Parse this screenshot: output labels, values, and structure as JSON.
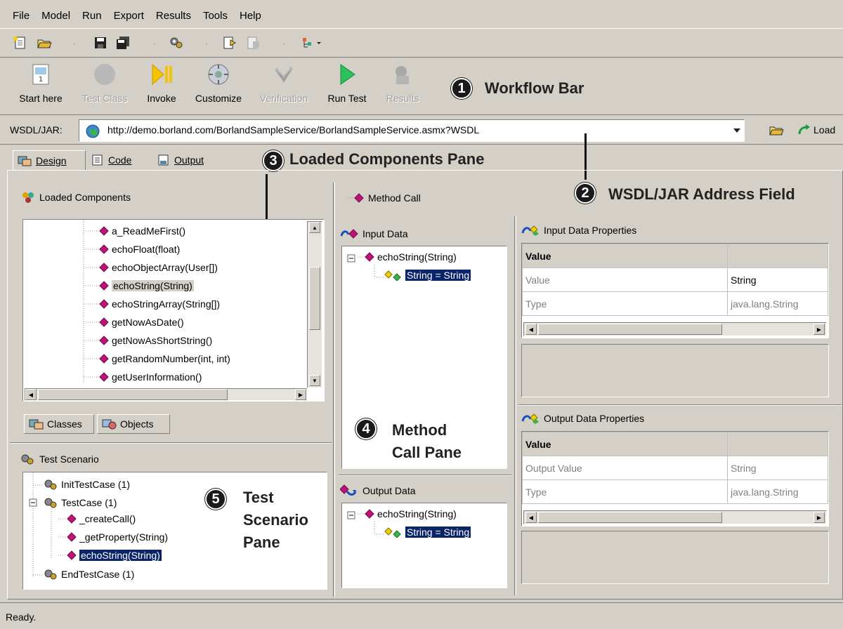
{
  "menu": [
    "File",
    "Model",
    "Run",
    "Export",
    "Results",
    "Tools",
    "Help"
  ],
  "workflow": {
    "start": "Start here",
    "test_class": "Test Class",
    "invoke": "Invoke",
    "customize": "Customize",
    "verification": "Verification",
    "run_test": "Run Test",
    "results": "Results"
  },
  "wsdl": {
    "label": "WSDL/JAR:",
    "value": "http://demo.borland.com/BorlandSampleService/BorlandSampleService.asmx?WSDL",
    "load": "Load"
  },
  "tabs": {
    "design": "Design",
    "code": "Code",
    "output": "Output"
  },
  "callouts": {
    "c1_num": "1",
    "c1": "Workflow Bar",
    "c2_num": "2",
    "c2": "WSDL/JAR Address Field",
    "c3_num": "3",
    "c3": "Loaded Components Pane",
    "c4_num": "4",
    "c4a": "Method",
    "c4b": "Call Pane",
    "c5_num": "5",
    "c5a": "Test",
    "c5b": "Scenario",
    "c5c": "Pane"
  },
  "loaded": {
    "title": "Loaded Components",
    "items": [
      "a_ReadMeFirst()",
      "echoFloat(float)",
      "echoObjectArray(User[])",
      "echoString(String)",
      "echoStringArray(String[])",
      "getNowAsDate()",
      "getNowAsShortString()",
      "getRandomNumber(int, int)",
      "getUserInformation()"
    ],
    "tab_classes": "Classes",
    "tab_objects": "Objects"
  },
  "scenario": {
    "title": "Test Scenario",
    "init": "InitTestCase (1)",
    "testcase": "TestCase (1)",
    "children": [
      "_createCall()",
      "_getProperty(String)",
      "echoString(String)"
    ],
    "end": "EndTestCase (1)"
  },
  "method": {
    "title": "Method Call",
    "input_title": "Input Data",
    "input_root": "echoString(String)",
    "input_child": "String = String",
    "output_title": "Output Data",
    "output_root": "echoString(String)",
    "output_child": "String = String"
  },
  "input_props": {
    "title": "Input Data Properties",
    "header": "Value",
    "rows": [
      [
        "Value",
        "String"
      ],
      [
        "Type",
        "java.lang.String"
      ]
    ]
  },
  "output_props": {
    "title": "Output Data Properties",
    "header": "Value",
    "rows": [
      [
        "Output Value",
        "String"
      ],
      [
        "Type",
        "java.lang.String"
      ]
    ]
  },
  "status": "Ready."
}
